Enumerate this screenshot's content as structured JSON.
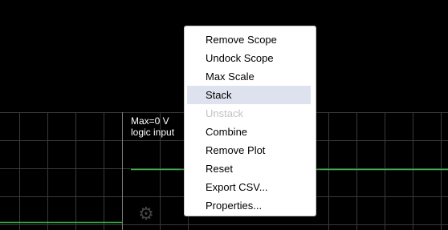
{
  "plot": {
    "label_line1": "Max=0 V",
    "label_line2": "logic input"
  },
  "colors": {
    "background": "#000000",
    "grid": "#3a3a3a",
    "trace": "#3cb34a",
    "menu_highlight": "#dee2ee",
    "menu_disabled_text": "#c2c2c2"
  },
  "settings_icon": "gear-icon",
  "context_menu": {
    "items": [
      {
        "label": "Remove Scope",
        "state": "normal"
      },
      {
        "label": "Undock Scope",
        "state": "normal"
      },
      {
        "label": "Max Scale",
        "state": "normal"
      },
      {
        "label": "Stack",
        "state": "highlighted"
      },
      {
        "label": "Unstack",
        "state": "disabled"
      },
      {
        "label": "Combine",
        "state": "normal"
      },
      {
        "label": "Remove Plot",
        "state": "normal"
      },
      {
        "label": "Reset",
        "state": "normal"
      },
      {
        "label": "Export CSV...",
        "state": "normal"
      },
      {
        "label": "Properties...",
        "state": "normal"
      }
    ]
  }
}
